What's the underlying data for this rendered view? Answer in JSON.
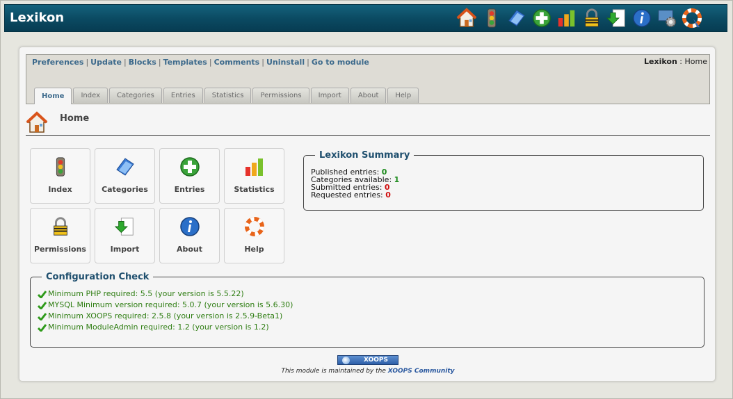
{
  "app": {
    "title": "Lexikon"
  },
  "top_icons": [
    "home-icon",
    "traffic-light-icon",
    "folder-icon",
    "add-icon",
    "stats-icon",
    "lock-icon",
    "import-icon",
    "info-icon",
    "settings-icon",
    "help-icon"
  ],
  "admin_links": [
    "Preferences",
    "Update",
    "Blocks",
    "Templates",
    "Comments",
    "Uninstall",
    "Go to module"
  ],
  "breadcrumb": {
    "module": "Lexikon",
    "separator": ":",
    "page": "Home"
  },
  "tabs": [
    "Home",
    "Index",
    "Categories",
    "Entries",
    "Statistics",
    "Permissions",
    "Import",
    "About",
    "Help"
  ],
  "page_title": "Home",
  "buttons": [
    {
      "label": "Index",
      "icon": "traffic-light-icon"
    },
    {
      "label": "Categories",
      "icon": "folder-icon"
    },
    {
      "label": "Entries",
      "icon": "add-icon"
    },
    {
      "label": "Statistics",
      "icon": "stats-icon"
    },
    {
      "label": "Permissions",
      "icon": "lock-icon"
    },
    {
      "label": "Import",
      "icon": "import-icon"
    },
    {
      "label": "About",
      "icon": "info-icon"
    },
    {
      "label": "Help",
      "icon": "help-icon"
    }
  ],
  "summary": {
    "title": "Lexikon Summary",
    "published_label": "Published entries:",
    "published": "0",
    "categories_label": "Categories available:",
    "categories": "1",
    "submitted_label": "Submitted entries:",
    "submitted": "0",
    "requested_label": "Requested entries:",
    "requested": "0"
  },
  "config": {
    "title": "Configuration Check",
    "lines": [
      "Minimum PHP required: 5.5 (your version is 5.5.22)",
      "MYSQL Minimum version required: 5.0.7 (your version is 5.6.30)",
      "Minimum XOOPS required: 2.5.8 (your version is 2.5.9-Beta1)",
      "Minimum ModuleAdmin required: 1.2 (your version is 1.2)"
    ]
  },
  "footer": {
    "logo_text": "XOOPS",
    "maintained_prefix": "This module is maintained by the ",
    "community_link": "XOOPS Community"
  },
  "colors": {
    "header": "#0b4b63",
    "link": "#3d6a8c",
    "ok": "#1a8a1a",
    "alert": "#d01010"
  }
}
